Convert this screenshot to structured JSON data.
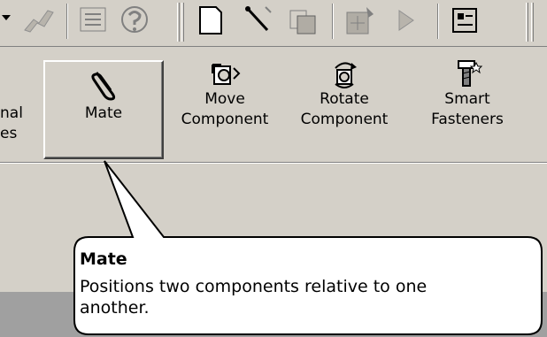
{
  "command_manager": {
    "partial_label_line1": "nal",
    "partial_label_line2": "es",
    "buttons": [
      {
        "id": "mate",
        "label": "Mate"
      },
      {
        "id": "move",
        "label_line1": "Move",
        "label_line2": "Component"
      },
      {
        "id": "rotate",
        "label_line1": "Rotate",
        "label_line2": "Component"
      },
      {
        "id": "fasteners",
        "label_line1": "Smart",
        "label_line2": "Fasteners"
      }
    ]
  },
  "tooltip": {
    "title": "Mate",
    "description": "Positions two components relative to one another."
  },
  "colors": {
    "face": "#d4d0c8",
    "shadow": "#808080",
    "highlight": "#ffffff",
    "tooltip_bg": "#ffffff",
    "lower_area": "#a0a0a0"
  },
  "icons": [
    "dropdown-arrow-icon",
    "sketch-icon",
    "list-icon",
    "help-icon",
    "new-document-icon",
    "magic-wand-icon",
    "copy-icon",
    "tools-icon",
    "play-icon",
    "options-icon",
    "paperclip-icon",
    "move-component-icon",
    "rotate-component-icon",
    "smart-fasteners-icon"
  ]
}
